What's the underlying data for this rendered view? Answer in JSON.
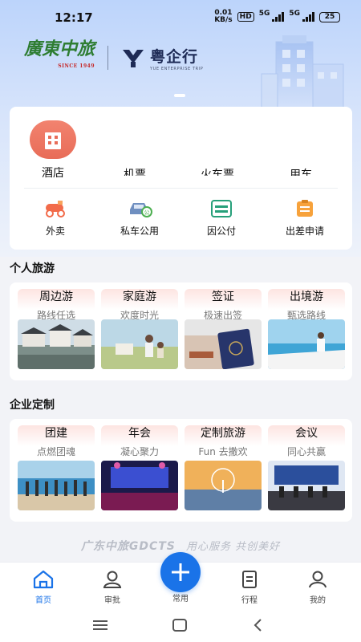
{
  "status_bar": {
    "time": "12:17",
    "speed_value": "0.01",
    "speed_unit": "KB/s",
    "hd": "HD",
    "net1": "5G",
    "net2": "5G",
    "battery": "25"
  },
  "header": {
    "logo_primary": "廣東中旅",
    "logo_primary_since": "SINCE 1949",
    "logo_secondary": "粤企行",
    "logo_secondary_sub": "YUE ENTERPRISE TRIP"
  },
  "services": {
    "row1": [
      {
        "label": "酒店",
        "icon": "hotel-icon"
      },
      {
        "label": "机票",
        "icon": "plane-icon"
      },
      {
        "label": "火车票",
        "icon": "train-icon"
      },
      {
        "label": "用车",
        "icon": "car-icon"
      }
    ],
    "row2": [
      {
        "label": "外卖",
        "icon": "scooter-icon"
      },
      {
        "label": "私车公用",
        "icon": "private-car-icon"
      },
      {
        "label": "因公付",
        "icon": "scan-pay-icon"
      },
      {
        "label": "出差申请",
        "icon": "application-icon"
      }
    ]
  },
  "personal_travel": {
    "title": "个人旅游",
    "items": [
      {
        "title": "周边游",
        "subtitle": "路线任选"
      },
      {
        "title": "家庭游",
        "subtitle": "欢度时光"
      },
      {
        "title": "签证",
        "subtitle": "极速出签"
      },
      {
        "title": "出境游",
        "subtitle": "甄选路线"
      }
    ]
  },
  "enterprise_custom": {
    "title": "企业定制",
    "items": [
      {
        "title": "团建",
        "subtitle": "点燃团魂"
      },
      {
        "title": "年会",
        "subtitle": "凝心聚力"
      },
      {
        "title": "定制旅游",
        "subtitle": "Fun 去撒欢"
      },
      {
        "title": "会议",
        "subtitle": "同心共赢"
      }
    ]
  },
  "footer": {
    "brand": "广东中旅GDCTS",
    "slogan": "用心服务  共创美好"
  },
  "tabbar": {
    "items": [
      {
        "label": "首页",
        "icon": "home-icon",
        "active": true
      },
      {
        "label": "审批",
        "icon": "approval-icon",
        "active": false
      },
      {
        "label": "常用",
        "icon": "plus-icon",
        "active": false
      },
      {
        "label": "行程",
        "icon": "itinerary-icon",
        "active": false
      },
      {
        "label": "我的",
        "icon": "profile-icon",
        "active": false
      }
    ]
  },
  "colors": {
    "accent": "#1a73e8",
    "hotel_icon": "#e86c58",
    "brand_green": "#2e7d32"
  }
}
